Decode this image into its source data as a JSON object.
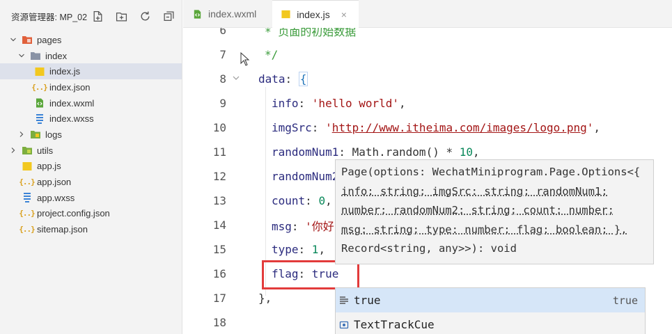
{
  "sidebar": {
    "title": "资源管理器: MP_02",
    "tree": [
      {
        "label": "pages",
        "type": "folder",
        "open": true,
        "depth": 0,
        "color": "#e0603b"
      },
      {
        "label": "index",
        "type": "folder",
        "open": true,
        "depth": 1,
        "color": "#8a93a6"
      },
      {
        "label": "index.js",
        "type": "js",
        "depth": 2,
        "selected": true
      },
      {
        "label": "index.json",
        "type": "json",
        "depth": 2
      },
      {
        "label": "index.wxml",
        "type": "wxml",
        "depth": 2
      },
      {
        "label": "index.wxss",
        "type": "wxss",
        "depth": 2
      },
      {
        "label": "logs",
        "type": "folder",
        "open": false,
        "depth": 1,
        "color": "#7cae3f"
      },
      {
        "label": "utils",
        "type": "folder",
        "open": false,
        "depth": 0,
        "color": "#7cae3f"
      },
      {
        "label": "app.js",
        "type": "js",
        "depth": 0
      },
      {
        "label": "app.json",
        "type": "json",
        "depth": 0
      },
      {
        "label": "app.wxss",
        "type": "wxss",
        "depth": 0
      },
      {
        "label": "project.config.json",
        "type": "json",
        "depth": 0
      },
      {
        "label": "sitemap.json",
        "type": "json",
        "depth": 0
      }
    ]
  },
  "tabs": [
    {
      "label": "index.wxml",
      "icon": "wxml-file-icon",
      "active": false
    },
    {
      "label": "index.js",
      "icon": "js-file-icon",
      "active": true,
      "close": "×"
    }
  ],
  "editor": {
    "lines": [
      {
        "n": "6"
      },
      {
        "n": "7"
      },
      {
        "n": "8"
      },
      {
        "n": "9"
      },
      {
        "n": "10"
      },
      {
        "n": "11"
      },
      {
        "n": "12"
      },
      {
        "n": "13"
      },
      {
        "n": "14"
      },
      {
        "n": "15"
      },
      {
        "n": "16"
      },
      {
        "n": "17"
      },
      {
        "n": "18"
      }
    ],
    "code": {
      "l6": "* 页面的初始数据",
      "l7": "*/",
      "l8_key": "data",
      "l9_key": "info",
      "l9_val": "'hello world'",
      "l10_key": "imgSrc",
      "l10_q1": "'",
      "l10_url": "http://www.itheima.com/images/logo.png",
      "l10_q2": "'",
      "l11_key": "randomNum1",
      "l11_obj": "Math",
      "l11_fn": "random",
      "l11_num": "10",
      "l12_key": "randomNum2",
      "l13_key": "count",
      "l13_val": "0",
      "l14_key": "msg",
      "l14_val": "'你好",
      "l15_key": "type",
      "l15_val": "1",
      "l16_key": "flag",
      "l16_val": "true",
      "l17": "},"
    },
    "hover_lines": [
      "Page(options: WechatMiniprogram.Page.Options<{",
      "info: string; imgSrc: string; randomNum1:",
      "number; randomNum2: string; count: number;",
      "msg: string; type: number; flag: boolean; },",
      "Record<string, any>>): void"
    ],
    "suggestions": [
      {
        "label": "true",
        "detail": "true",
        "icon": "keyword-icon",
        "selected": true
      },
      {
        "label": "TextTrackCue",
        "detail": "",
        "icon": "class-icon",
        "selected": false
      }
    ]
  },
  "colors": {
    "highlight_box": "#e23b3b",
    "selected_row": "#dde1eb",
    "suggestion_selected": "#d6e6f8"
  }
}
